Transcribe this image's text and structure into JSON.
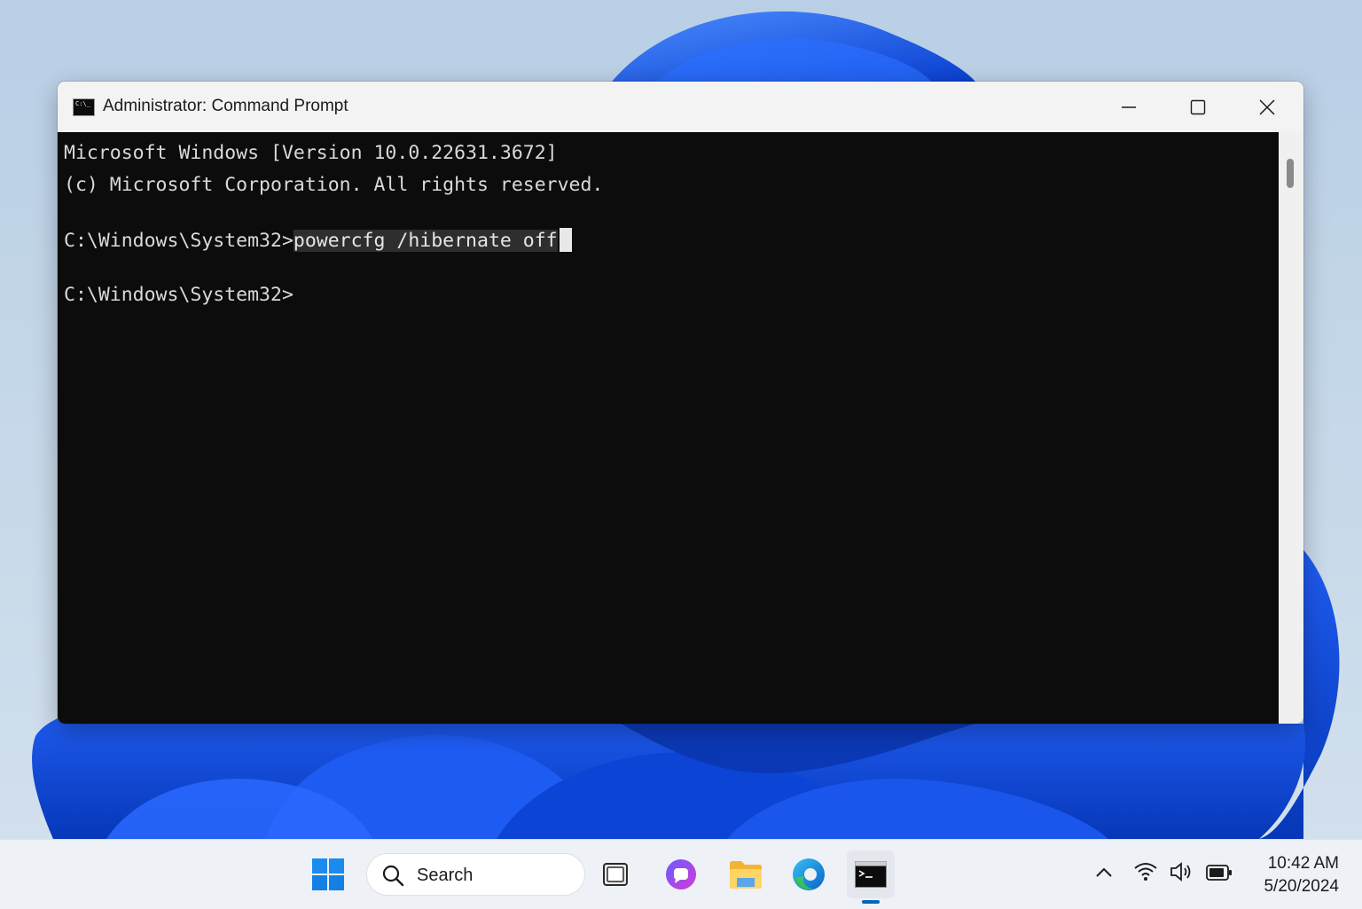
{
  "window": {
    "title": "Administrator: Command Prompt",
    "icon": "cmd-icon",
    "controls": [
      "minimize-icon",
      "maximize-icon",
      "close-icon"
    ]
  },
  "console": {
    "line1": "Microsoft Windows [Version 10.0.22631.3672]",
    "line2": "(c) Microsoft Corporation. All rights reserved.",
    "prompt1": "C:\\Windows\\System32>",
    "command": "powercfg /hibernate off",
    "prompt2": "C:\\Windows\\System32>"
  },
  "taskbar": {
    "search_label": "Search",
    "apps": [
      "windows-start-icon",
      "task-view-icon",
      "copilot-icon",
      "file-explorer-icon",
      "edge-icon",
      "command-prompt-icon"
    ],
    "tray": [
      "chevron-up-icon",
      "wifi-icon",
      "volume-icon",
      "battery-icon"
    ],
    "time": "10:42 AM",
    "date": "5/20/2024"
  },
  "colors": {
    "console_bg": "#0c0c0c",
    "console_text": "#d9d9d9",
    "accent": "#0067c0"
  }
}
